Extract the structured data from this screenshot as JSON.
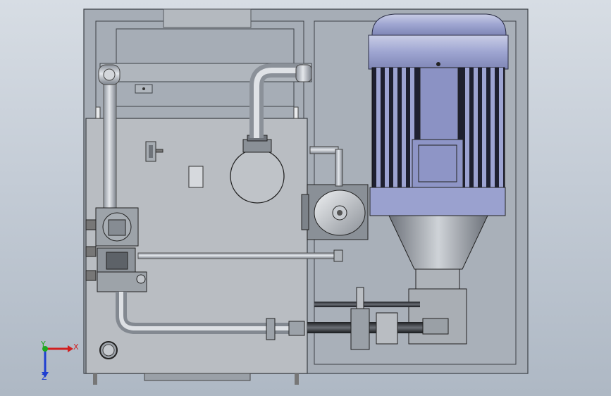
{
  "view": {
    "background_top": "#d7dde4",
    "background_bottom": "#aeb8c4"
  },
  "triad": {
    "x_label": "X",
    "y_label": "Y",
    "z_label": "Z",
    "x_color": "#d11f1f",
    "y_color": "#1fa81f",
    "z_color": "#1f3fd1"
  },
  "model": {
    "frame_color": "#9aa3ad",
    "tank_color": "#b7bcc2",
    "motor_color": "#8f97c9",
    "pipe_color": "#a9afb8",
    "dark_pipe_color": "#2a2c30"
  }
}
